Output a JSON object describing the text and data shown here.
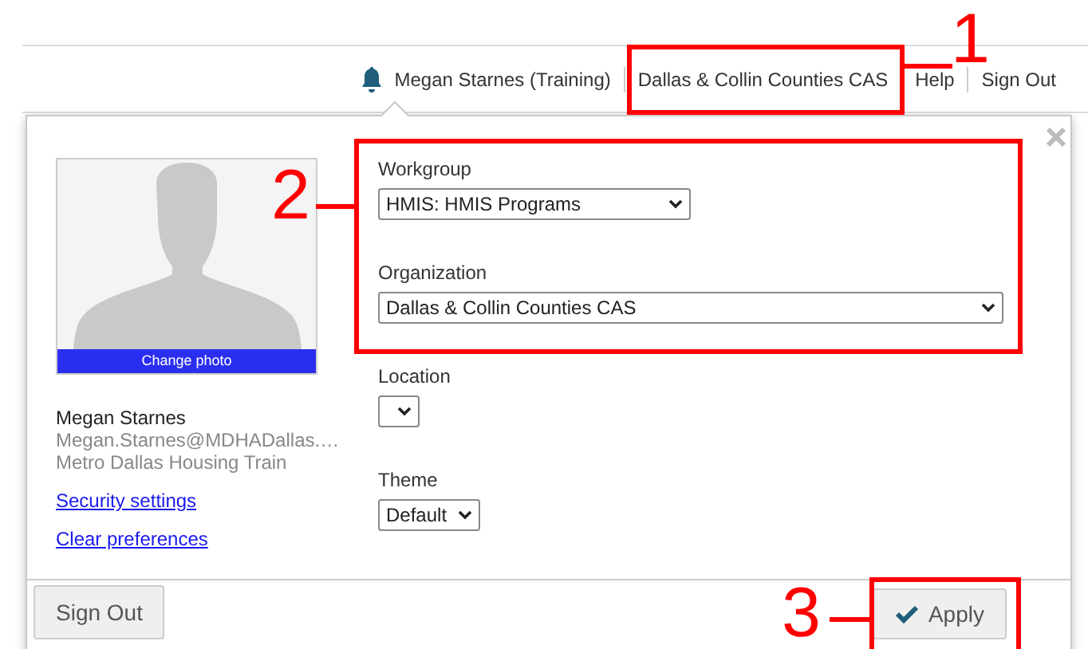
{
  "header": {
    "user_name": "Megan Starnes (Training)",
    "organization_link": "Dallas & Collin Counties CAS",
    "links": [
      "Help",
      "Sign Out"
    ]
  },
  "popup": {
    "change_photo": "Change photo",
    "profile": {
      "name": "Megan Starnes",
      "email": "Megan.Starnes@MDHADallas.…",
      "agency": "Metro Dallas Housing Train"
    },
    "links": [
      "Security settings",
      "Clear preferences"
    ],
    "fields": [
      {
        "label": "Workgroup",
        "value": "HMIS: HMIS Programs"
      },
      {
        "label": "Organization",
        "value": "Dallas & Collin Counties CAS"
      },
      {
        "label": "Location"
      },
      {
        "label": "Theme",
        "value": "Default"
      }
    ],
    "sign_out_button": "Sign Out",
    "apply_button": "Apply"
  },
  "callouts": [
    {
      "number": "1"
    },
    {
      "number": "2"
    },
    {
      "number": "3"
    }
  ]
}
